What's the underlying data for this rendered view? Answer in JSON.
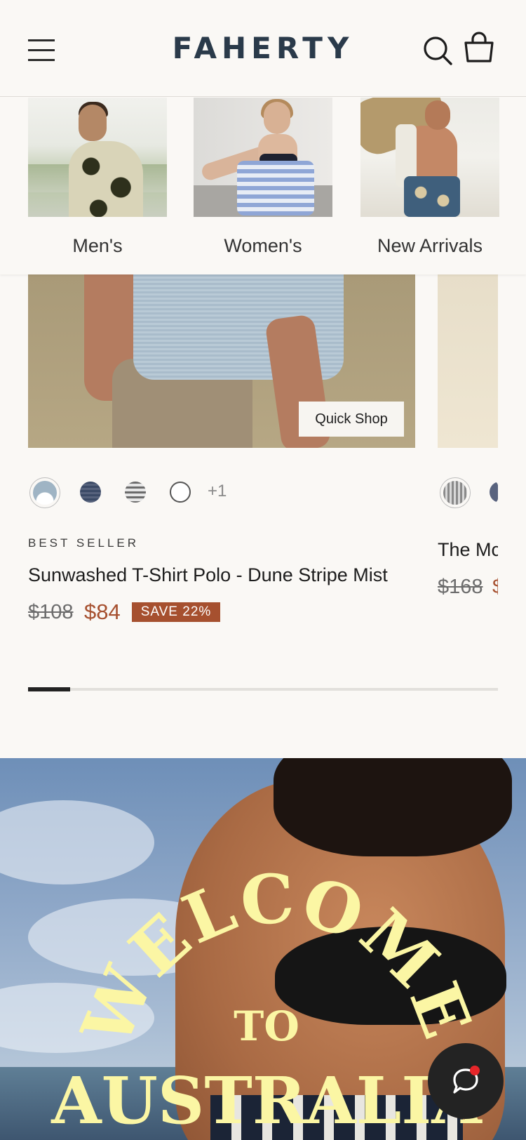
{
  "header": {
    "brand": "FAHERTY",
    "icons": [
      "hamburger-menu-icon",
      "search-icon",
      "shopping-bag-icon"
    ]
  },
  "categories": [
    {
      "label": "Men's"
    },
    {
      "label": "Women's"
    },
    {
      "label": "New Arrivals"
    }
  ],
  "product": {
    "quick_shop_label": "Quick Shop",
    "more_colors": "+1",
    "badge": "BEST SELLER",
    "name": "Sunwashed T-Shirt Polo - Dune Stripe Mist",
    "price_original": "$108",
    "price_sale": "$84",
    "save_label": "SAVE 22%"
  },
  "product_next": {
    "name": "The Mc",
    "price_original": "$168",
    "price_sale": "$"
  },
  "carousel": {
    "progress": 0.09
  },
  "hero": {
    "welcome_word": "WELCOME",
    "to_word": "TO",
    "place_word": "AUSTRALIA"
  },
  "chat": {
    "icon": "chat-bubble-icon",
    "has_notification": true
  },
  "colors": {
    "brand_text": "#2a3a4a",
    "sale": "#a6502f",
    "hero_text": "#fbf6a4",
    "chat_button": "#232323",
    "notification": "#e6262a"
  }
}
